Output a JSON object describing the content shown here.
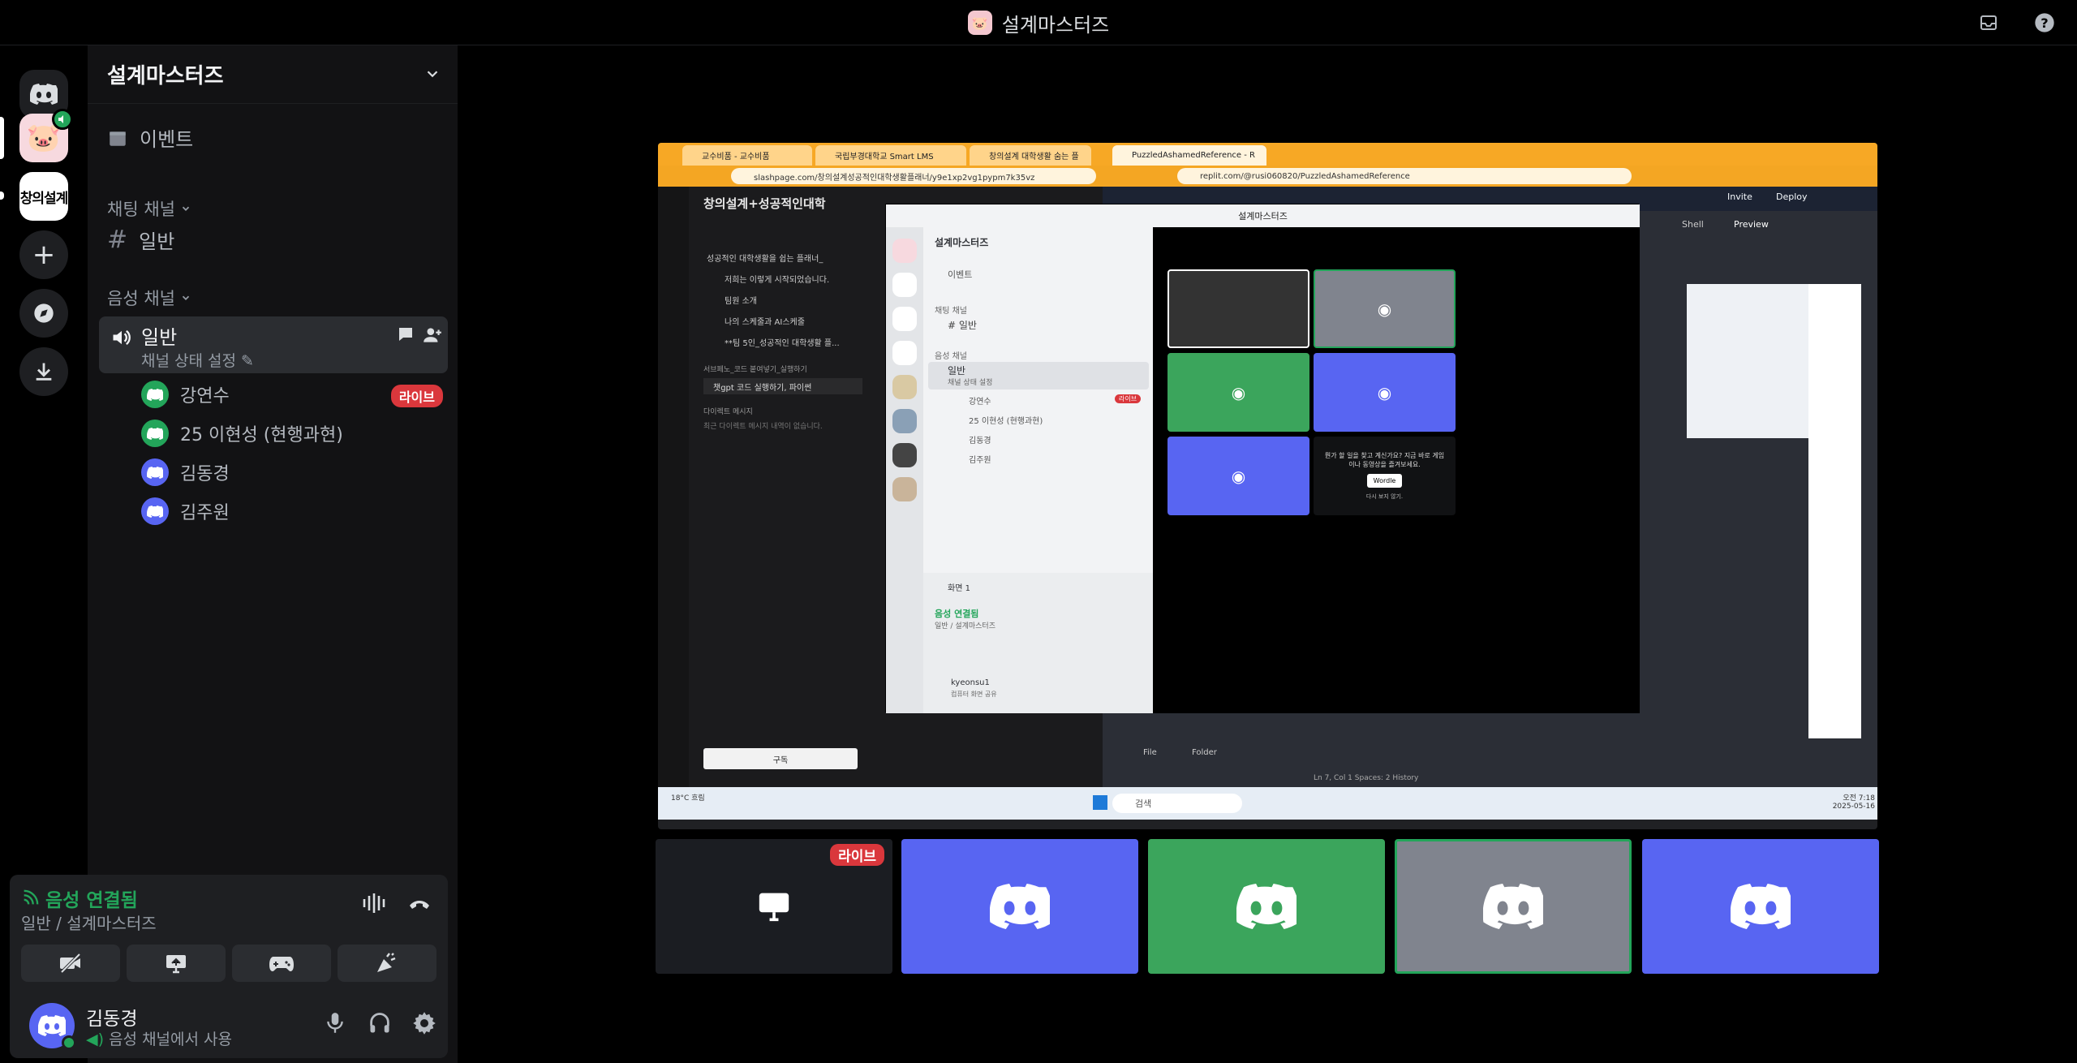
{
  "window": {
    "title": "설계마스터즈"
  },
  "server": {
    "name": "설계마스터즈",
    "events_label": "이벤트",
    "text_category": "채팅 채널",
    "text_channel": "일반",
    "voice_category": "음성 채널",
    "voice_channel": {
      "name": "일반",
      "status": "채널 상태 설정"
    },
    "members": [
      {
        "name": "강연수",
        "color": "#23a55a",
        "live": "라이브"
      },
      {
        "name": "25 이현성 (현행과현)",
        "color": "#23a55a"
      },
      {
        "name": "김동경",
        "color": "#5865f2"
      },
      {
        "name": "김주원",
        "color": "#5865f2"
      }
    ]
  },
  "rail": {
    "server2_label": "창의설계"
  },
  "voice_panel": {
    "connected": "음성 연결됨",
    "location": "일반 / 설계마스터즈"
  },
  "user": {
    "name": "김동경",
    "status": "음성 채널에서 사용"
  },
  "stream": {
    "tabs": [
      "교수비품 - 교수비품",
      "국립부경대학교 Smart LMS",
      "창의설계 대학생활 숨는 플",
      "PuzzledAshamedReference - R"
    ],
    "url_left": "slashpage.com/창의설계성공적인대학생활플래너/y9e1xp2vg1pypm7k35vz",
    "url_right": "replit.com/@rusi060820/PuzzledAshamedReference",
    "left_page_title": "창의설계+성공적인대학",
    "left_items": [
      "성공적인 대학생활을 쉽는 플래너_",
      "저희는 이렇게 시작되었습니다.",
      "팀원 소개",
      "나의 스케줄과 AI스케줄",
      "**팀 5인_성공적인 대학생활 플..."
    ],
    "left_extra": [
      "서브페노_코드 붙여넣기_실행하기",
      "챗gpt 코드 실행하기, 파이썬",
      "다이렉트 메시지",
      "최근 다이렉트 메시지 내역이 없습니다."
    ],
    "subscribe": "구독",
    "replit_invite": "Invite",
    "replit_deploy": "Deploy",
    "replit_shell": "Shell",
    "replit_preview": "Preview",
    "replit_file": "File",
    "replit_folder": "Folder",
    "replit_status": "Ln 7, Col 1   Spaces: 2   History",
    "taskbar_weather": "18°C 흐림",
    "taskbar_search": "검색",
    "taskbar_time": "오전 7:18",
    "taskbar_date": "2025-05-16",
    "inner_title": "설계마스터즈",
    "inner_server": "설계마스터즈",
    "inner_events": "이벤트",
    "inner_text_cat": "채팅 채널",
    "inner_text_ch": "일반",
    "inner_voice_cat": "음성 채널",
    "inner_voice_ch": "일반",
    "inner_voice_status": "채널 상태 설정",
    "inner_members": [
      "강연수",
      "25 이현성 (현행과현)",
      "김동경",
      "김주원"
    ],
    "inner_live": "라이브",
    "inner_screen": "화면 1",
    "inner_conn": "음성 연결됨",
    "inner_loc": "일반 / 설계마스터즈",
    "inner_user": "kyeonsu1",
    "inner_user_status": "컴퓨터 화면 공유",
    "promo_text": "뭔가 할 일을 찾고 계신가요? 지금 바로 게임이나 동영상을 즐겨보세요.",
    "promo_game": "Wordle",
    "promo_check": "다시 보지 않기."
  },
  "tiles": [
    {
      "kind": "screen",
      "live": "라이브"
    },
    {
      "kind": "user",
      "color": "#5865f2"
    },
    {
      "kind": "user",
      "color": "#3ba55c"
    },
    {
      "kind": "user",
      "color": "#80848e",
      "selected": true
    },
    {
      "kind": "user",
      "color": "#5865f2"
    }
  ],
  "icons": [
    "discord-icon",
    "inbox-icon",
    "help-icon",
    "calendar-icon",
    "speaker-icon",
    "chat-icon",
    "add-user-icon",
    "camera-off-icon",
    "screen-share-icon",
    "gamepad-icon",
    "soundboard-icon",
    "mic-icon",
    "headphones-icon",
    "gear-icon",
    "hangup-icon",
    "soundwave-icon"
  ]
}
